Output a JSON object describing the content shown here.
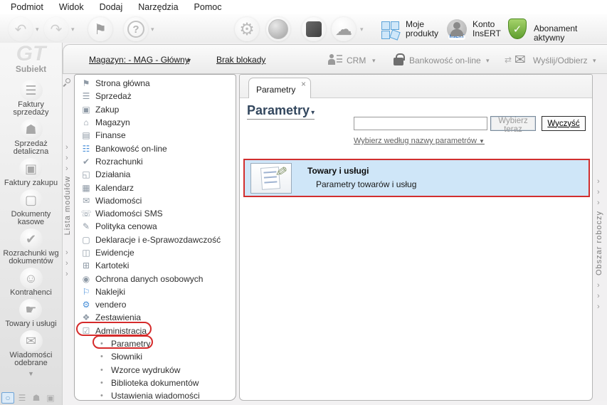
{
  "menu": {
    "items": [
      "Podmiot",
      "Widok",
      "Dodaj",
      "Narzędzia",
      "Pomoc"
    ]
  },
  "icons": {
    "back": "↶",
    "forward": "↷",
    "flag": "⚑",
    "help": "?",
    "gear_dots": "⚙",
    "cloud_db": "☁",
    "envelope": "✉",
    "shield_check": "✓",
    "dropdown_small": "▾",
    "dropdown": "▼",
    "chevron": "›",
    "close": "×",
    "bullet": "•",
    "more_down": "▼",
    "pencil": "✎"
  },
  "toolbar": {
    "moje_produkty": "Moje produkty",
    "konto_insert": "Konto InsERT",
    "insert_badge": "InsERT",
    "abonament": "Abonament aktywny"
  },
  "subtoolbar": {
    "magazyn": "Magazyn: - MAG - Główny",
    "brak_blokady": "Brak blokady",
    "crm": "CRM",
    "bankowosc": "Bankowość on-line",
    "wyslij": "Wyślij/Odbierz"
  },
  "sidebar": {
    "logo": "GT",
    "brand": "Subiekt",
    "items": [
      {
        "glyph": "☰",
        "label": "Faktury sprzedaży"
      },
      {
        "glyph": "☗",
        "label": "Sprzedaż detaliczna"
      },
      {
        "glyph": "▣",
        "label": "Faktury zakupu"
      },
      {
        "glyph": "▢",
        "label": "Dokumenty kasowe"
      },
      {
        "glyph": "✔",
        "label": "Rozrachunki wg dokumentów"
      },
      {
        "glyph": "☺",
        "label": "Kontrahenci"
      },
      {
        "glyph": "☛",
        "label": "Towary i usługi"
      },
      {
        "glyph": "✉",
        "label": "Wiadomości odebrane"
      }
    ],
    "bottom_icons": [
      {
        "glyph": "○"
      },
      {
        "glyph": "☰"
      },
      {
        "glyph": "☗"
      },
      {
        "glyph": "▣"
      }
    ]
  },
  "modules": {
    "strip_label": "Lista modułów",
    "items": [
      {
        "glyph": "⚑",
        "label": "Strona główna"
      },
      {
        "glyph": "☰",
        "label": "Sprzedaż"
      },
      {
        "glyph": "▣",
        "label": "Zakup"
      },
      {
        "glyph": "⌂",
        "label": "Magazyn"
      },
      {
        "glyph": "▤",
        "label": "Finanse"
      },
      {
        "glyph": "☷",
        "label": "Bankowość on-line"
      },
      {
        "glyph": "✔",
        "label": "Rozrachunki"
      },
      {
        "glyph": "◱",
        "label": "Działania"
      },
      {
        "glyph": "▦",
        "label": "Kalendarz"
      },
      {
        "glyph": "✉",
        "label": "Wiadomości"
      },
      {
        "glyph": "☏",
        "label": "Wiadomości SMS"
      },
      {
        "glyph": "✎",
        "label": "Polityka cenowa"
      },
      {
        "glyph": "▢",
        "label": "Deklaracje i e-Sprawozdawczość"
      },
      {
        "glyph": "◫",
        "label": "Ewidencje"
      },
      {
        "glyph": "⊞",
        "label": "Kartoteki"
      },
      {
        "glyph": "◉",
        "label": "Ochrona danych osobowych"
      },
      {
        "glyph": "⚐",
        "label": "Naklejki"
      },
      {
        "glyph": "⚙",
        "label": "vendero"
      },
      {
        "glyph": "❖",
        "label": "Zestawienia"
      },
      {
        "glyph": "☑",
        "label": "Administracja"
      }
    ],
    "sub_items": [
      {
        "label": "Parametry"
      },
      {
        "label": "Słowniki"
      },
      {
        "label": "Wzorce wydruków"
      },
      {
        "label": "Biblioteka dokumentów"
      },
      {
        "label": "Ustawienia wiadomości"
      }
    ]
  },
  "main": {
    "tab": "Parametry",
    "title": "Parametry",
    "search_value": "",
    "select_button": "Wybierz teraz",
    "clear_button": "Wyczyść",
    "filter_link": "Wybierz według nazwy parametrów",
    "result": {
      "title": "Towary i usługi",
      "subtitle": "Parametry towarów i usług"
    }
  },
  "right_strip": {
    "label": "Obszar roboczy"
  },
  "colors": {
    "highlight_red": "#d12f2f",
    "result_bg": "#cfe6f8",
    "title_navy": "#33475e",
    "tile_blue": "#5ba3d9",
    "shield_green": "#5f9e2f"
  }
}
